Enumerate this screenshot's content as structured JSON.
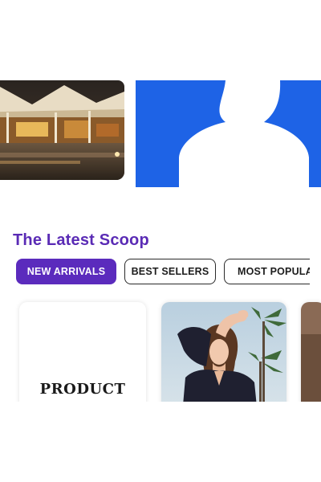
{
  "section": {
    "title": "The Latest Scoop"
  },
  "tabs": [
    {
      "label": "NEW ARRIVALS",
      "active": true
    },
    {
      "label": "BEST SELLERS",
      "active": false
    },
    {
      "label": "MOST POPULA",
      "active": false
    }
  ],
  "products": [
    {
      "placeholder_text": "PRODUCT"
    }
  ],
  "colors": {
    "accent": "#5b2bbd",
    "title": "#5a2bb5",
    "profile_banner": "#1e63e6"
  }
}
